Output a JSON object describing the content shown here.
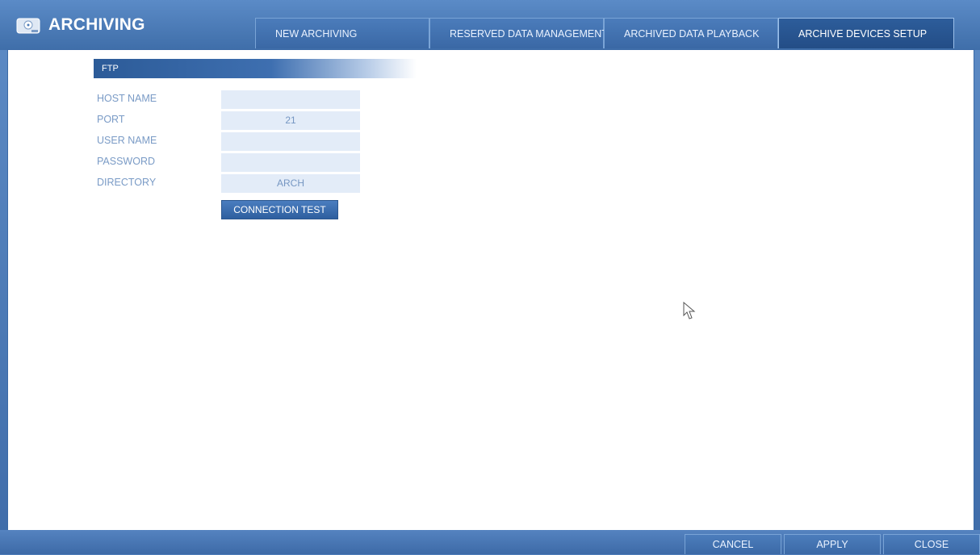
{
  "header": {
    "app_title": "ARCHIVING",
    "tabs": [
      {
        "label": "NEW ARCHIVING"
      },
      {
        "label": "RESERVED DATA MANAGEMENT"
      },
      {
        "label": "ARCHIVED DATA PLAYBACK"
      },
      {
        "label": "ARCHIVE DEVICES SETUP",
        "active": true
      }
    ],
    "app_icon": "disc-drive-icon"
  },
  "ftp": {
    "section_title": "FTP",
    "fields": [
      {
        "label": "HOST NAME",
        "value": ""
      },
      {
        "label": "PORT",
        "value": "21"
      },
      {
        "label": "USER NAME",
        "value": ""
      },
      {
        "label": "PASSWORD",
        "value": ""
      },
      {
        "label": "DIRECTORY",
        "value": "ARCH"
      }
    ],
    "connection_test_label": "CONNECTION TEST"
  },
  "footer": {
    "cancel_label": "CANCEL",
    "apply_label": "APPLY",
    "close_label": "CLOSE"
  },
  "colors": {
    "frame_blue": "#4f7db9",
    "active_tab": "#2d5d9b",
    "field_bg": "#e3ecf8",
    "label_text": "#7a9bc6"
  }
}
